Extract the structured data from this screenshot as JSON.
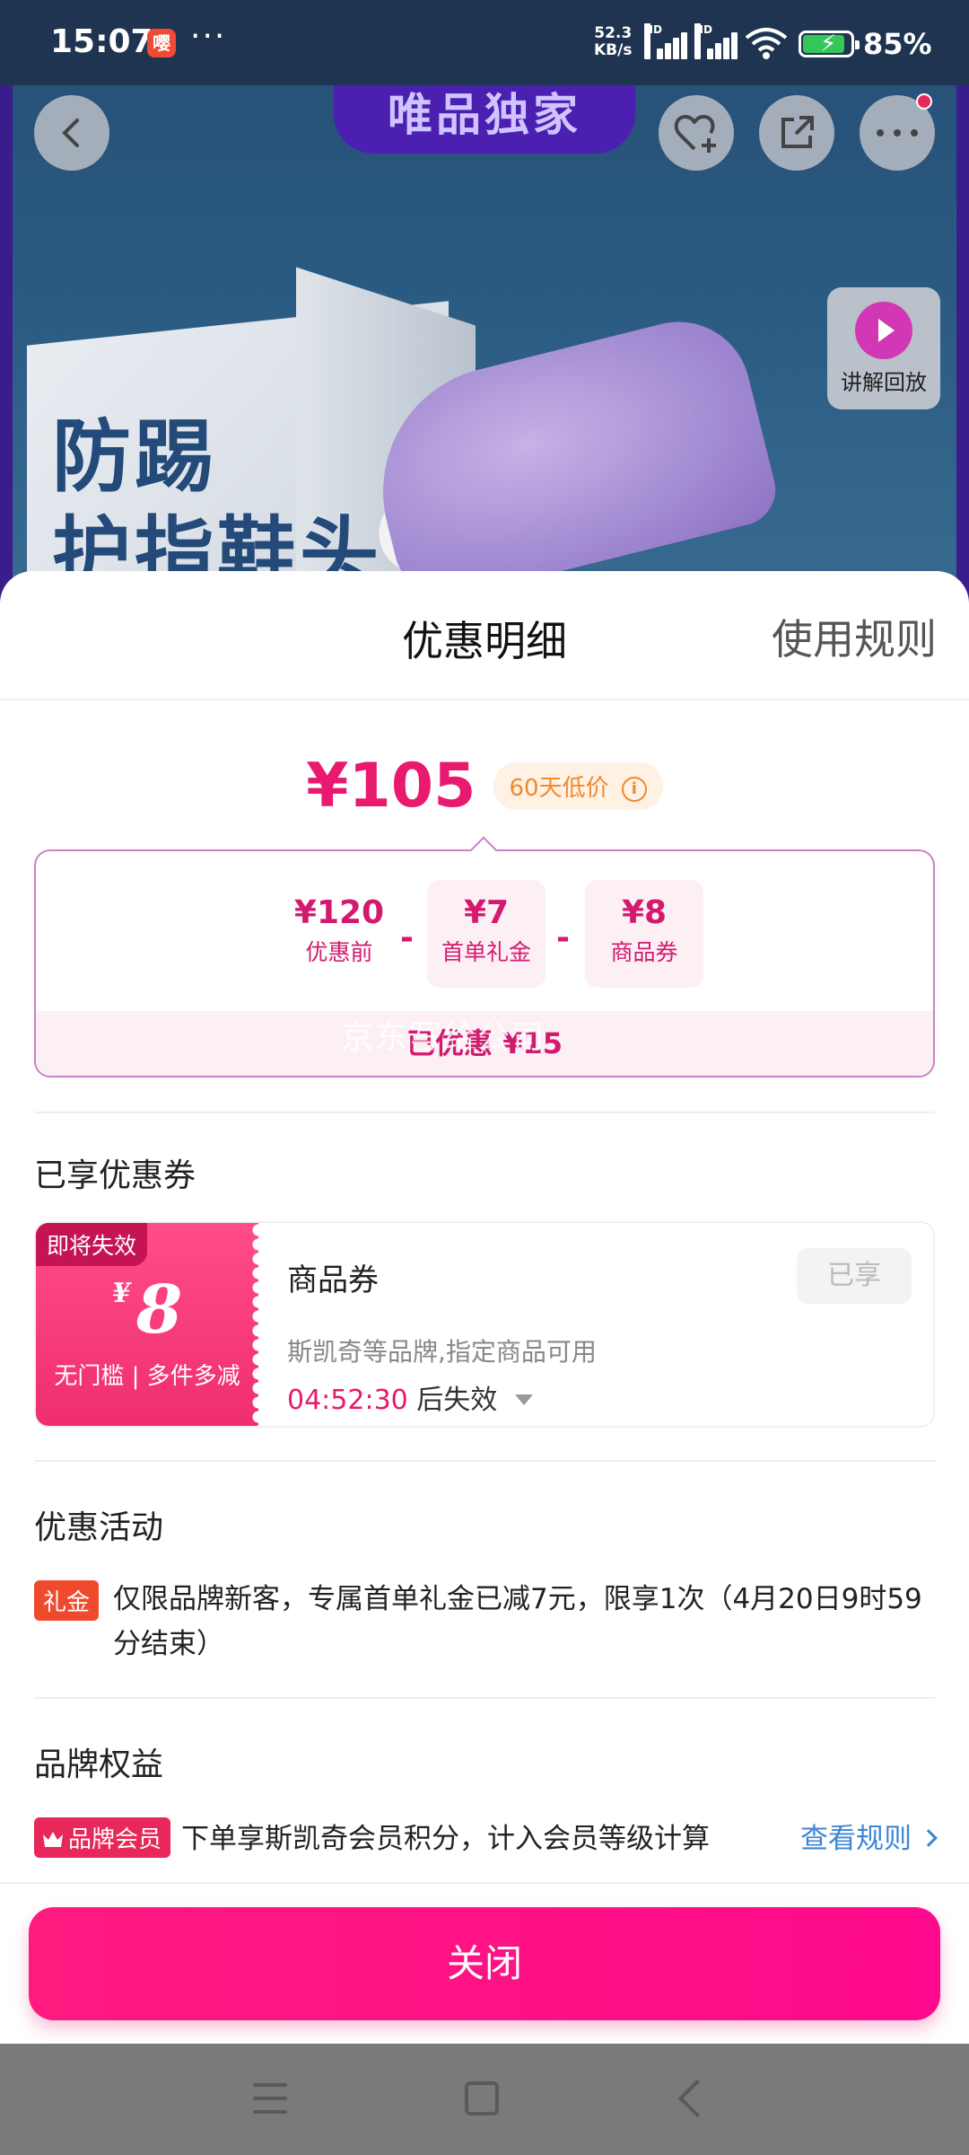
{
  "status_bar": {
    "time": "15:07",
    "app_icon_glyph": "嘤",
    "more": "···",
    "net_speed_value": "52.3",
    "net_speed_unit": "KB/s",
    "hd_label": "HD",
    "battery_percent": "85%",
    "battery_level": 0.85
  },
  "product_page": {
    "top_badge": "唯品独家",
    "slogan_line1": "防踢",
    "slogan_line2": "护指鞋头",
    "replay_label": "讲解回放",
    "icons": [
      "back-arrow-icon",
      "heart-plus-icon",
      "share-icon",
      "more-dots-icon"
    ]
  },
  "sheet": {
    "title": "优惠明细",
    "rules_link": "使用规则",
    "final_price": "¥105",
    "price_tag": "60天低价",
    "breakdown": {
      "items": [
        {
          "value": "¥120",
          "label": "优惠前"
        },
        {
          "value": "¥7",
          "label": "首单礼金"
        },
        {
          "value": "¥8",
          "label": "商品券"
        }
      ],
      "operator": "-",
      "total": "已优惠 ¥15",
      "watermark": "京东写给公司"
    },
    "coupons_section": {
      "title": "已享优惠券",
      "coupon": {
        "expire_badge": "即将失效",
        "amount_symbol": "¥",
        "amount": "8",
        "condition": "无门槛 | 多件多减",
        "name": "商品券",
        "used_label": "已享",
        "scope": "斯凯奇等品牌,指定商品可用",
        "countdown": "04:52:30",
        "countdown_suffix": "后失效"
      }
    },
    "activity_section": {
      "title": "优惠活动",
      "tag": "礼金",
      "text": "仅限品牌新客，专属首单礼金已减7元，限享1次（4月20日9时59分结束）"
    },
    "brand_section": {
      "title": "品牌权益",
      "tag": "品牌会员",
      "text": "下单享斯凯奇会员积分，计入会员等级计算",
      "link": "查看规则"
    },
    "close_button": "关闭"
  },
  "colors": {
    "accent": "#e8196e",
    "button": "#ff0a8c",
    "link": "#3c86d6",
    "tag_orange": "#f08a2c"
  }
}
